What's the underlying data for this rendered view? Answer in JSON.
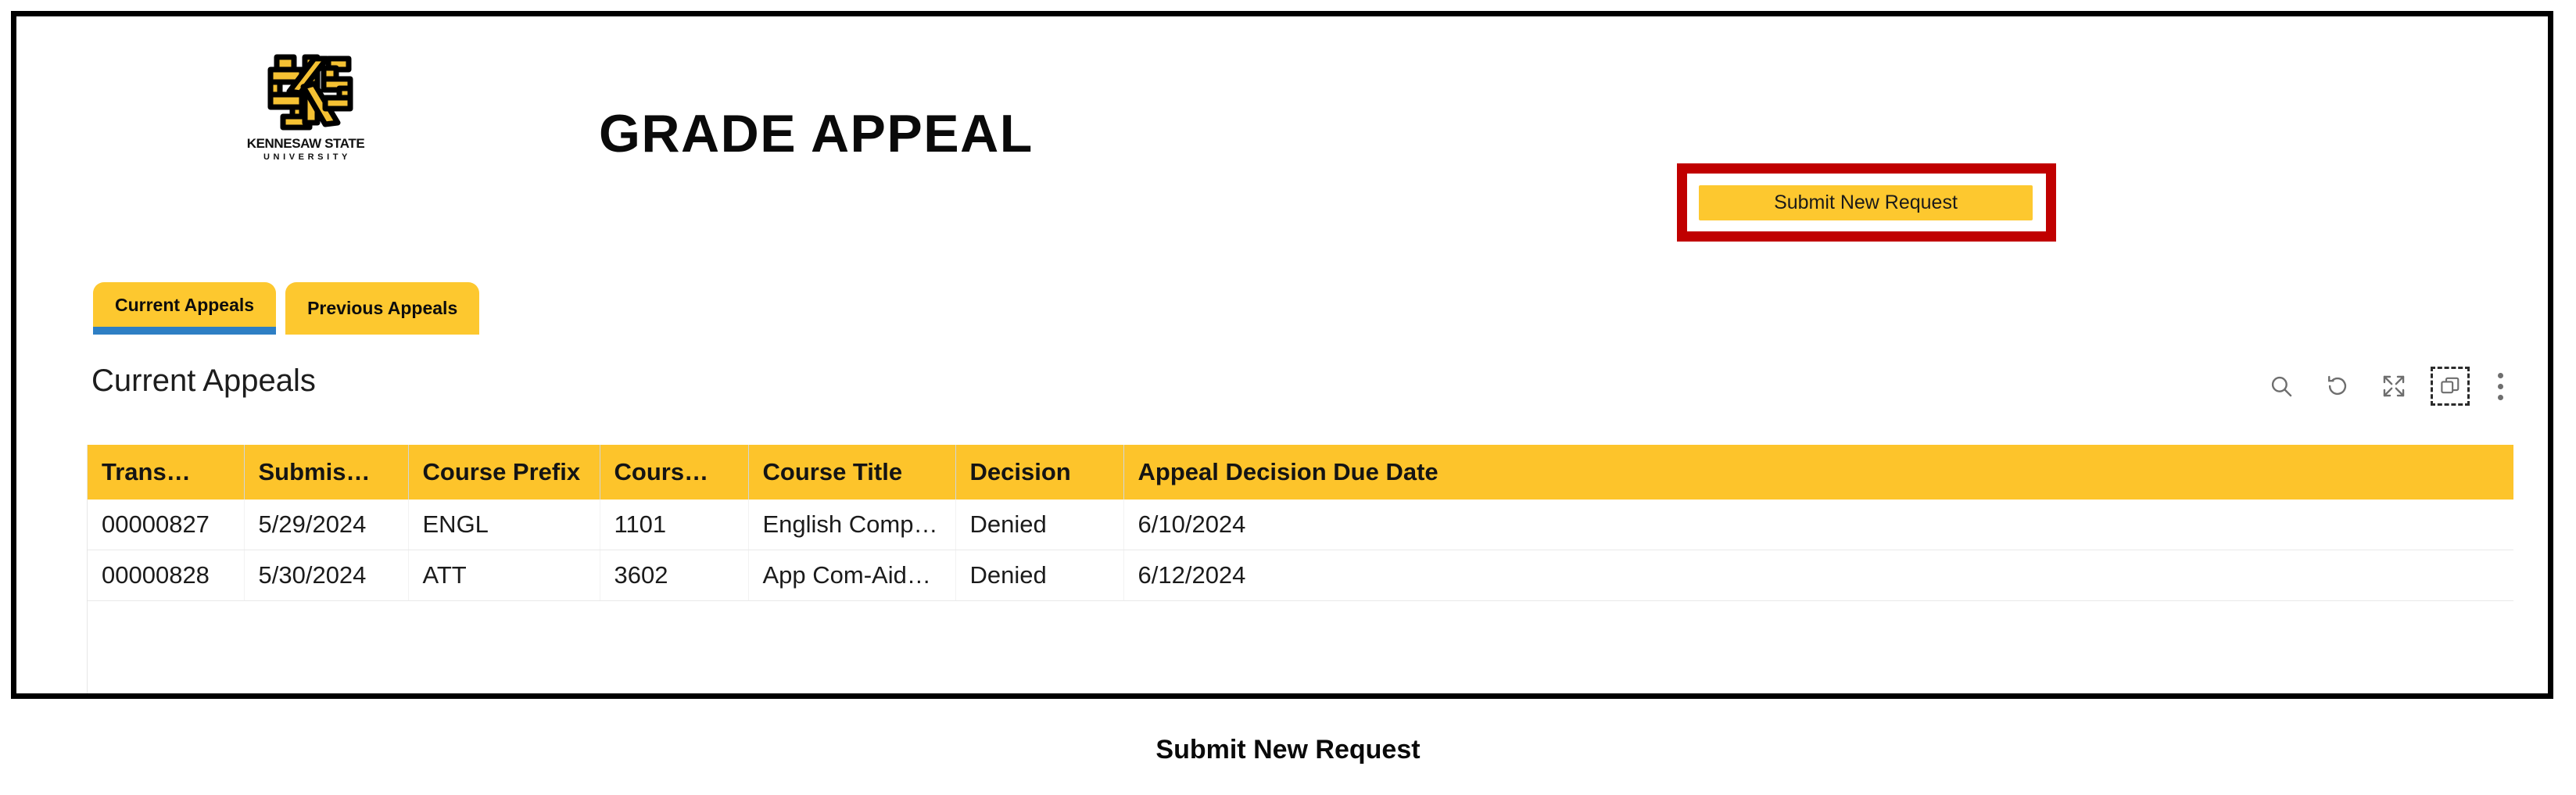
{
  "brand": {
    "logo_icon": "ksu-owl-monogram-icon",
    "wordmark": "KENNESAW STATE",
    "sub_wordmark": "UNIVERSITY",
    "gold": "#FDC82F",
    "black": "#000000"
  },
  "header": {
    "title": "GRADE APPEAL"
  },
  "actions": {
    "submit_new_request": "Submit New Request",
    "annotation_color": "#C00000"
  },
  "tabs": [
    {
      "label": "Current Appeals",
      "active": true
    },
    {
      "label": "Previous Appeals",
      "active": false
    }
  ],
  "list": {
    "title": "Current Appeals",
    "accent_blue": "#2E7FC4",
    "header_yellow": "#FDC42B"
  },
  "toolbar": [
    {
      "name": "search-icon",
      "label": "Search",
      "focused": false
    },
    {
      "name": "refresh-icon",
      "label": "Refresh",
      "focused": false
    },
    {
      "name": "expand-icon",
      "label": "Expand",
      "focused": false
    },
    {
      "name": "popout-icon",
      "label": "Pop out",
      "focused": true
    },
    {
      "name": "more-options-icon",
      "label": "More options",
      "focused": false
    }
  ],
  "table": {
    "columns": [
      "Trans…",
      "Submis…",
      "Course Prefix",
      "Cours…",
      "Course Title",
      "Decision",
      "Appeal Decision Due Date"
    ],
    "rows": [
      {
        "transaction": "00000827",
        "submission_date": "5/29/2024",
        "course_prefix": "ENGL",
        "course_number": "1101",
        "course_title": "English Comp…",
        "decision": "Denied",
        "appeal_decision_due_date": "6/10/2024"
      },
      {
        "transaction": "00000828",
        "submission_date": "5/30/2024",
        "course_prefix": "ATT",
        "course_number": "3602",
        "course_title": "App Com-Aid…",
        "decision": "Denied",
        "appeal_decision_due_date": "6/12/2024"
      }
    ]
  },
  "caption": "Submit New Request"
}
